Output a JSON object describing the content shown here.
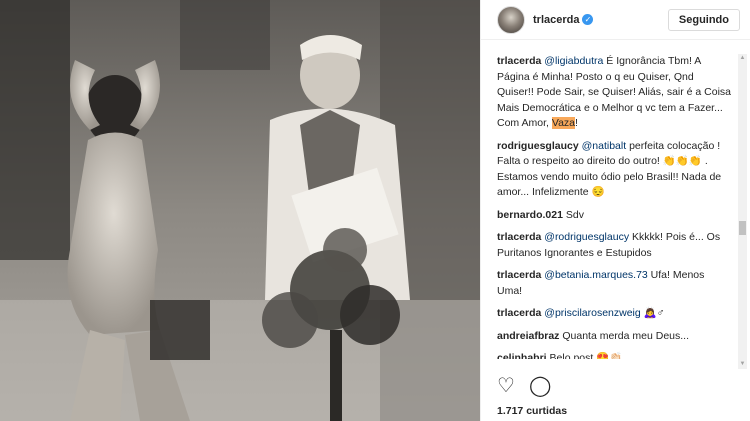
{
  "post": {
    "username": "trlacerda",
    "verified_badge": "✓",
    "follow_label": "Seguindo",
    "likes": "1.717 curtidas"
  },
  "comments": [
    {
      "user": "trlacerda",
      "parts": [
        {
          "t": "@ligiabdutra",
          "m": true
        },
        {
          "t": " É Ignorância Tbm! A Página é Minha! Posto o q eu Quiser, Qnd Quiser!! Pode Sair, se Quiser! Aliás, sair é a Coisa Mais Democrática e o Melhor q vc tem a Fazer... Com Amor, "
        },
        {
          "t": "Vaza",
          "h": true
        },
        {
          "t": "!"
        }
      ]
    },
    {
      "user": "rodriguesglaucy",
      "parts": [
        {
          "t": "@natibalt",
          "m": true
        },
        {
          "t": " perfeita colocação ! Falta o respeito ao direito do outro! 👏👏👏 . Estamos vendo muito ódio pelo Brasil!! Nada de amor... Infelizmente 😔"
        }
      ]
    },
    {
      "user": "bernardo.021",
      "parts": [
        {
          "t": " Sdv"
        }
      ]
    },
    {
      "user": "trlacerda",
      "parts": [
        {
          "t": "@rodriguesglaucy",
          "m": true
        },
        {
          "t": " Kkkkk! Pois é... Os Puritanos Ignorantes e Estupidos"
        }
      ]
    },
    {
      "user": "trlacerda",
      "parts": [
        {
          "t": "@betania.marques.73",
          "m": true
        },
        {
          "t": " Ufa! Menos Uma!"
        }
      ]
    },
    {
      "user": "trlacerda",
      "parts": [
        {
          "t": "@priscilarosenzweig",
          "m": true
        },
        {
          "t": " 🙇‍♀️♂"
        }
      ]
    },
    {
      "user": "andreiafbraz",
      "parts": [
        {
          "t": " Quanta merda meu Deus..."
        }
      ]
    },
    {
      "user": "celinhabri",
      "parts": [
        {
          "t": " Belo post 😍👏🏻"
        }
      ]
    }
  ],
  "icons": {
    "like": "heart-icon",
    "comment": "comment-icon"
  },
  "colors": {
    "mention": "#003569",
    "highlight": "#f8a85a",
    "verified": "#3897f0"
  }
}
